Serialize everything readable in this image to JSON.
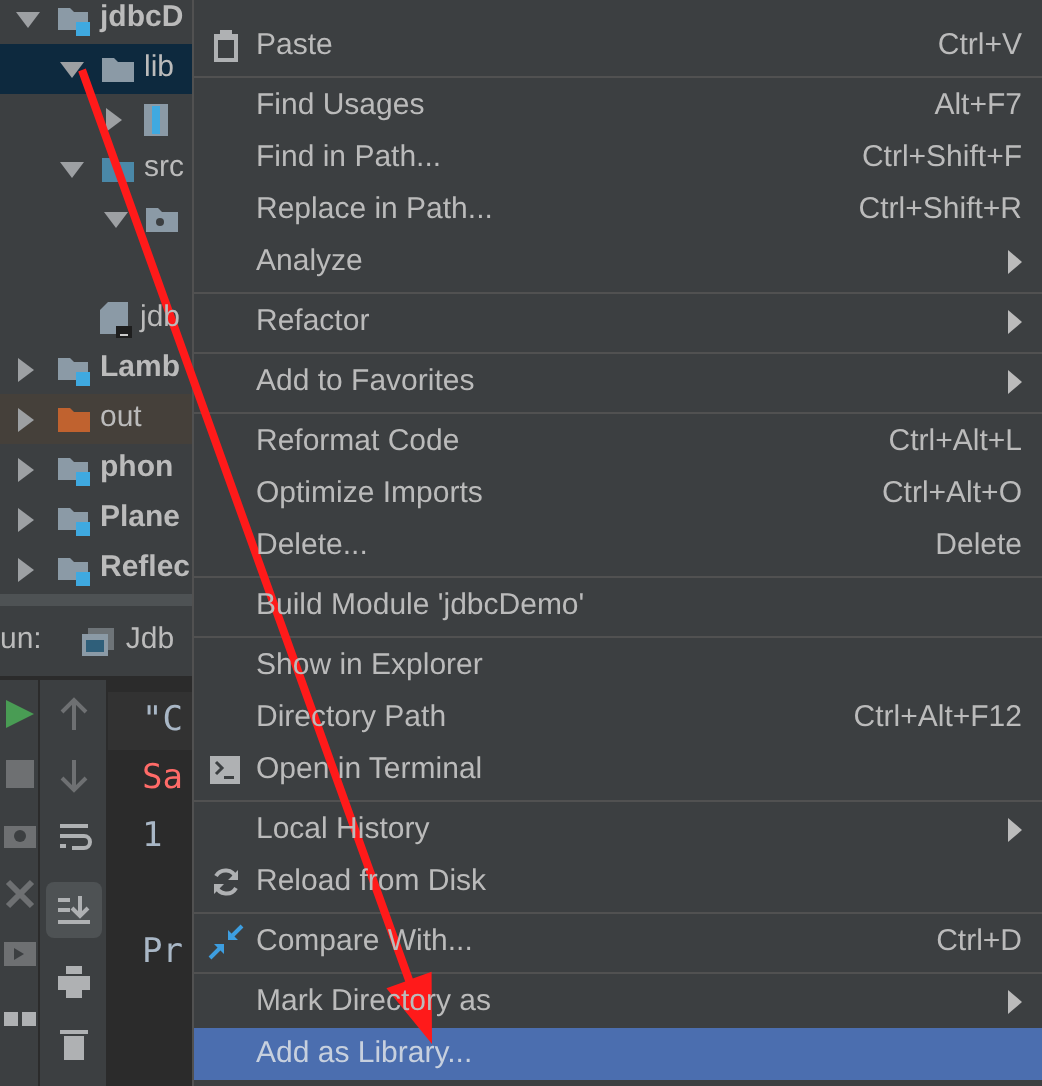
{
  "project_tree": [
    {
      "label": "jdbcD",
      "kind": "module",
      "expanded": true,
      "selected": false,
      "children": [
        {
          "label": "lib",
          "kind": "folder",
          "expanded": true,
          "selected": true,
          "children": [
            {
              "kind": "jar",
              "expanded": false,
              "selected": false
            }
          ]
        },
        {
          "label": "src",
          "kind": "source-folder",
          "expanded": true,
          "selected": false,
          "children": [
            {
              "kind": "package",
              "expanded": true,
              "selected": false
            }
          ]
        },
        {
          "label": "jdb",
          "kind": "file",
          "selected": false
        }
      ]
    },
    {
      "label": "Lamb",
      "kind": "module",
      "expanded": false,
      "selected": false
    },
    {
      "label": "out",
      "kind": "excluded-folder",
      "expanded": false,
      "selected": false
    },
    {
      "label": "phon",
      "kind": "module",
      "expanded": false,
      "selected": false
    },
    {
      "label": "Plane",
      "kind": "module",
      "expanded": false,
      "selected": false
    },
    {
      "label": "Reflec",
      "kind": "module",
      "expanded": false,
      "selected": false
    }
  ],
  "run_panel": {
    "label": "un:",
    "tab": "Jdb",
    "console": [
      {
        "kind": "command",
        "text": "\"C"
      },
      {
        "kind": "error",
        "text": "Sa"
      },
      {
        "kind": "output",
        "text": "1"
      },
      {
        "kind": "exit",
        "text": "Pr"
      }
    ]
  },
  "context_menu": [
    {
      "kind": "paste",
      "label": "Paste",
      "shortcut": "Ctrl+V",
      "submenu": false,
      "selected": false
    },
    {
      "kind": "separator"
    },
    {
      "kind": "item",
      "label": "Find Usages",
      "shortcut": "Alt+F7",
      "submenu": false,
      "selected": false
    },
    {
      "kind": "item",
      "label": "Find in Path...",
      "shortcut": "Ctrl+Shift+F",
      "submenu": false,
      "selected": false
    },
    {
      "kind": "item",
      "label": "Replace in Path...",
      "shortcut": "Ctrl+Shift+R",
      "submenu": false,
      "selected": false
    },
    {
      "kind": "item",
      "label": "Analyze",
      "submenu": true,
      "selected": false
    },
    {
      "kind": "separator"
    },
    {
      "kind": "item",
      "label": "Refactor",
      "submenu": true,
      "selected": false
    },
    {
      "kind": "separator"
    },
    {
      "kind": "item",
      "label": "Add to Favorites",
      "submenu": true,
      "selected": false
    },
    {
      "kind": "separator"
    },
    {
      "kind": "item",
      "label": "Reformat Code",
      "shortcut": "Ctrl+Alt+L",
      "submenu": false,
      "selected": false
    },
    {
      "kind": "item",
      "label": "Optimize Imports",
      "shortcut": "Ctrl+Alt+O",
      "submenu": false,
      "selected": false
    },
    {
      "kind": "item",
      "label": "Delete...",
      "shortcut": "Delete",
      "submenu": false,
      "selected": false
    },
    {
      "kind": "separator"
    },
    {
      "kind": "item",
      "label": "Build Module 'jdbcDemo'",
      "submenu": false,
      "selected": false
    },
    {
      "kind": "separator"
    },
    {
      "kind": "item",
      "label": "Show in Explorer",
      "submenu": false,
      "selected": false
    },
    {
      "kind": "item",
      "label": "Directory Path",
      "shortcut": "Ctrl+Alt+F12",
      "submenu": false,
      "selected": false
    },
    {
      "kind": "terminal",
      "label": "Open in Terminal",
      "submenu": false,
      "selected": false
    },
    {
      "kind": "separator"
    },
    {
      "kind": "item",
      "label": "Local History",
      "submenu": true,
      "selected": false
    },
    {
      "kind": "reload",
      "label": "Reload from Disk",
      "submenu": false,
      "selected": false
    },
    {
      "kind": "separator"
    },
    {
      "kind": "compare",
      "label": "Compare With...",
      "shortcut": "Ctrl+D",
      "submenu": false,
      "selected": false
    },
    {
      "kind": "separator"
    },
    {
      "kind": "item",
      "label": "Mark Directory as",
      "submenu": true,
      "selected": false
    },
    {
      "kind": "item",
      "label": "Add as Library...",
      "submenu": false,
      "selected": true
    }
  ]
}
